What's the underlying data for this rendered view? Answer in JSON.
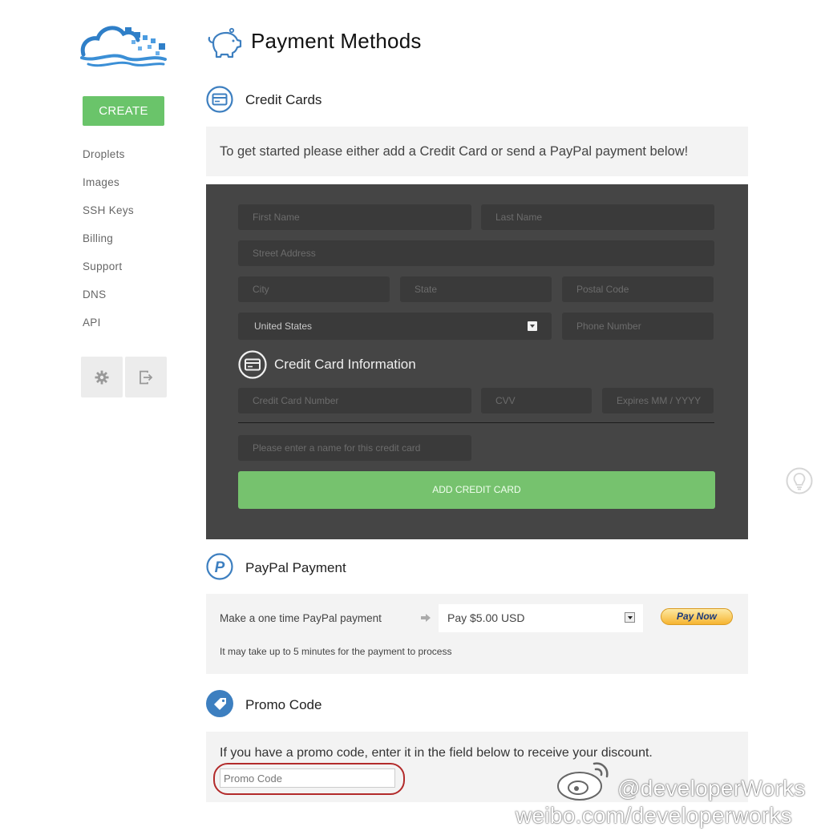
{
  "page_title": "Payment Methods",
  "sidebar": {
    "create_label": "CREATE",
    "items": [
      {
        "label": "Droplets"
      },
      {
        "label": "Images"
      },
      {
        "label": "SSH Keys"
      },
      {
        "label": "Billing"
      },
      {
        "label": "Support"
      },
      {
        "label": "DNS"
      },
      {
        "label": "API"
      }
    ]
  },
  "credit_cards": {
    "title": "Credit Cards",
    "intro": "To get started please either add a Credit Card or send a PayPal payment below!",
    "form": {
      "first_name_placeholder": "First Name",
      "last_name_placeholder": "Last Name",
      "street_placeholder": "Street Address",
      "city_placeholder": "City",
      "state_placeholder": "State",
      "postal_placeholder": "Postal Code",
      "country_value": "United States",
      "phone_placeholder": "Phone Number",
      "cc_info_title": "Credit Card Information",
      "cc_number_placeholder": "Credit Card Number",
      "cvv_placeholder": "CVV",
      "expires_placeholder": "Expires MM / YYYY",
      "card_name_placeholder": "Please enter a name for this credit card",
      "add_button": "ADD CREDIT CARD"
    }
  },
  "paypal": {
    "title": "PayPal Payment",
    "label": "Make a one time PayPal payment",
    "amount_selected": "Pay $5.00 USD",
    "pay_now": "Pay Now",
    "note": "It may take up to 5 minutes for the payment to process"
  },
  "promo": {
    "title": "Promo Code",
    "text": "If you have a promo code, enter it in the field below to receive your discount.",
    "placeholder": "Promo Code"
  },
  "watermark": {
    "handle": "@developerWorks",
    "url": "weibo.com/developerworks"
  },
  "colors": {
    "accent_green": "#6ac46a",
    "icon_blue": "#3d7fc0",
    "form_dark": "#454545"
  }
}
